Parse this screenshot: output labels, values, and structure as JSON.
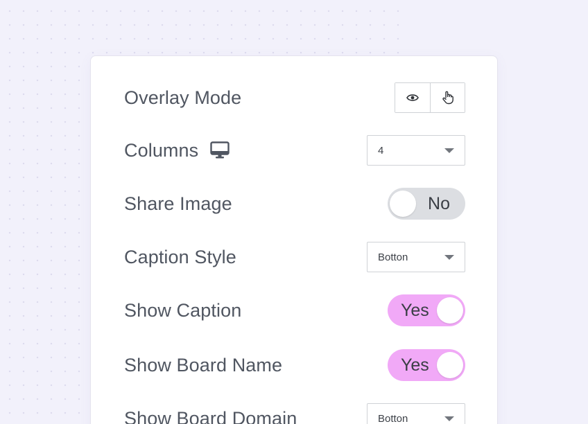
{
  "settings": {
    "overlay_mode": {
      "label": "Overlay Mode",
      "options": [
        "eye-icon",
        "pointer-hand-icon"
      ]
    },
    "columns": {
      "label": "Columns",
      "icon": "desktop-monitor-icon",
      "value": "4"
    },
    "share_image": {
      "label": "Share Image",
      "value": "No"
    },
    "caption_style": {
      "label": "Caption Style",
      "value": "Botton"
    },
    "show_caption": {
      "label": "Show Caption",
      "value": "Yes"
    },
    "show_board_name": {
      "label": "Show Board Name",
      "value": "Yes"
    },
    "show_board_domain": {
      "label": "Show Board Domain",
      "value": "Botton"
    }
  },
  "colors": {
    "background": "#f2f1fb",
    "toggle_on": "#f1a9f7",
    "toggle_off": "#dcdee2",
    "label_text": "#505661"
  }
}
